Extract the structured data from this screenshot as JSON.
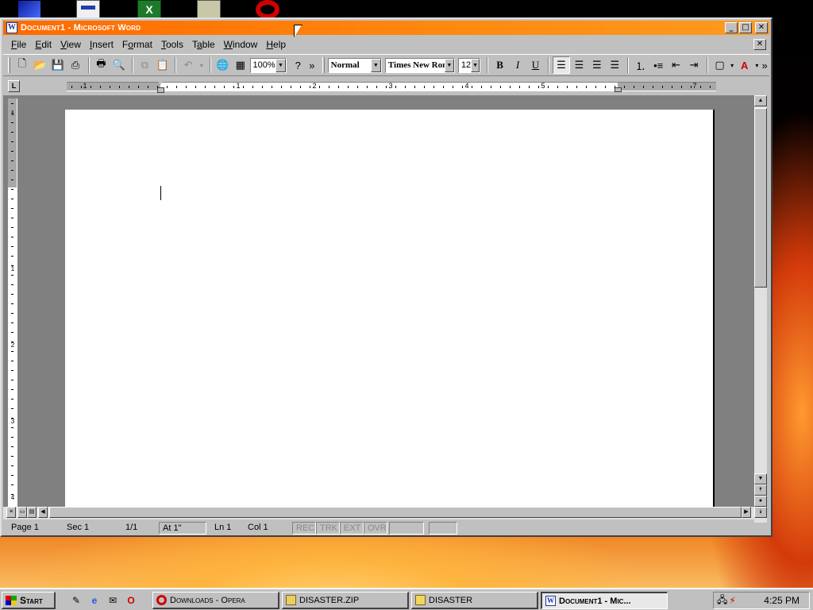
{
  "desktop": {
    "icons": [
      "satellite-icon",
      "printer-icon",
      "excel-icon",
      "clock-icon",
      "opera-icon"
    ]
  },
  "window": {
    "title": "Document1 - Microsoft Word",
    "min_glyph": "_",
    "max_glyph": "□",
    "close_glyph": "✕",
    "doc_close_glyph": "✕"
  },
  "menu": {
    "items": [
      {
        "u": "F",
        "rest": "ile"
      },
      {
        "u": "E",
        "rest": "dit"
      },
      {
        "u": "V",
        "rest": "iew"
      },
      {
        "u": "I",
        "rest": "nsert"
      },
      {
        "u": "F",
        "rest": "ormat",
        "prefix": ""
      },
      {
        "u": "T",
        "rest": "ools"
      },
      {
        "u": "T",
        "rest": "able",
        "prefix": ""
      },
      {
        "u": "W",
        "rest": "indow"
      },
      {
        "u": "H",
        "rest": "elp"
      }
    ]
  },
  "toolbar": {
    "zoom": "100%",
    "style": "Normal",
    "font": "Times New Ron",
    "size": "12",
    "bold": "B",
    "italic": "I",
    "underline": "U",
    "font_color": "A",
    "more": "»"
  },
  "ruler": {
    "tab_selector": "L",
    "h_numbers": [
      "1",
      "1",
      "2",
      "3",
      "4",
      "5",
      "7"
    ],
    "v_numbers": [
      "1",
      "1",
      "2",
      "3",
      "4"
    ]
  },
  "status": {
    "page": "Page 1",
    "sec": "Sec 1",
    "pages": "1/1",
    "at": "At 1\"",
    "ln": "Ln 1",
    "col": "Col 1",
    "rec": "REC",
    "trk": "TRK",
    "ext": "EXT",
    "ovr": "OVR"
  },
  "taskbar": {
    "start": "Start",
    "tasks": [
      {
        "label": "Downloads - Opera",
        "icon": "opera-icon"
      },
      {
        "label": "DISASTER.ZIP",
        "icon": "zip-folder-icon"
      },
      {
        "label": "DISASTER",
        "icon": "folder-icon"
      },
      {
        "label": "Document1 - Mic...",
        "icon": "word-icon",
        "active": true
      }
    ],
    "clock": "4:25 PM"
  }
}
